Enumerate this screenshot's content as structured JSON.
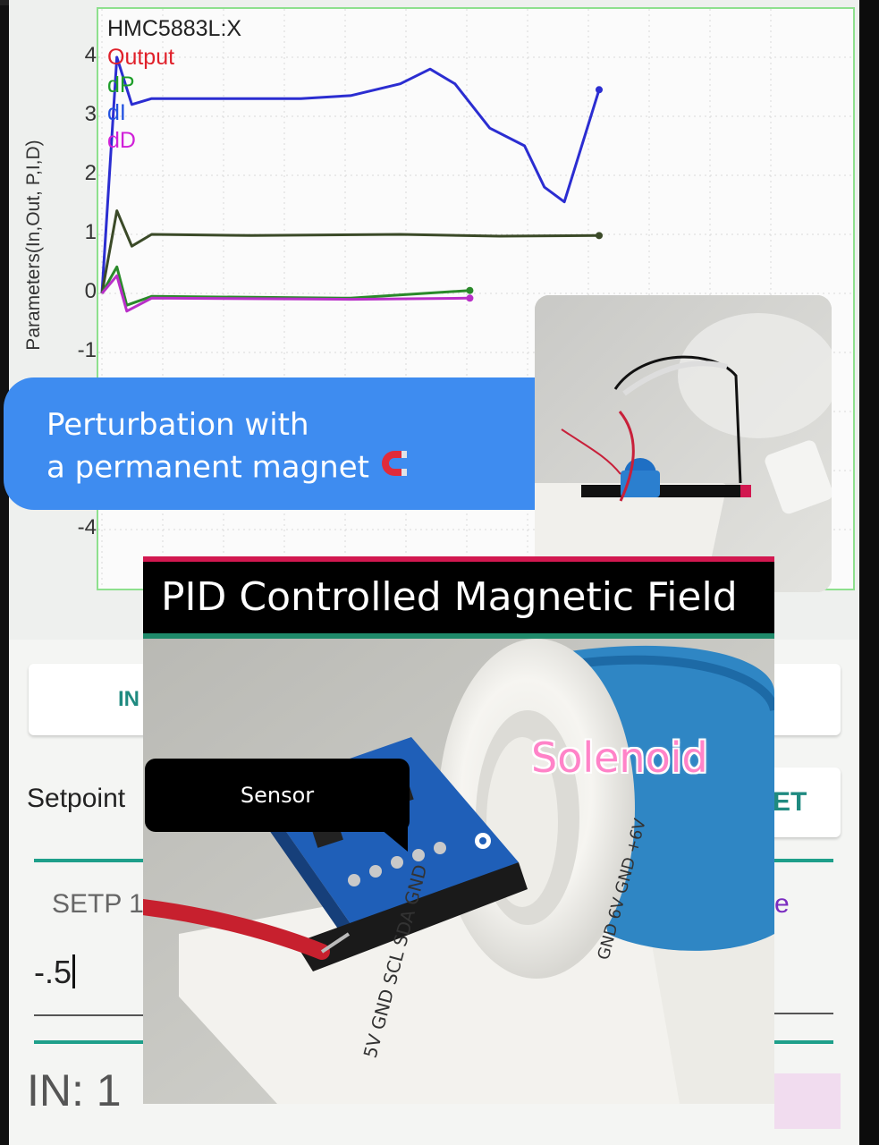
{
  "chart_data": {
    "type": "line",
    "title": "HMC5883L:X",
    "ylabel": "Parameters(In,Out, P,I,D)",
    "ylim": [
      -4,
      4
    ],
    "yticks": [
      "4",
      "3",
      "2",
      "1",
      "0",
      "-1",
      "-4"
    ],
    "legend": [
      "Output",
      "dP",
      "dI",
      "dD"
    ],
    "legend_colors": [
      "#e0202a",
      "#1e9e2a",
      "#2050e0",
      "#d020d8"
    ],
    "series": [
      {
        "name": "Output",
        "color": "#2b2dd1",
        "x": [
          0,
          0.3,
          0.6,
          1,
          2,
          4,
          5,
          6,
          6.6,
          7.1,
          7.8,
          8.5,
          8.9,
          9.3,
          10
        ],
        "y": [
          0,
          4.0,
          3.2,
          3.3,
          3.3,
          3.3,
          3.35,
          3.55,
          3.8,
          3.55,
          2.8,
          2.5,
          1.8,
          1.55,
          3.45
        ]
      },
      {
        "name": "dP",
        "color": "#3b4a28",
        "x": [
          0,
          0.3,
          0.6,
          1,
          3,
          6,
          8,
          10
        ],
        "y": [
          0,
          1.4,
          0.8,
          1.0,
          0.98,
          1.0,
          0.97,
          0.98
        ]
      },
      {
        "name": "dI",
        "color": "#2a8a2a",
        "x": [
          0,
          0.3,
          0.5,
          1,
          5,
          7.4
        ],
        "y": [
          0,
          0.45,
          -0.2,
          -0.05,
          -0.08,
          0.05
        ]
      },
      {
        "name": "dD",
        "color": "#b92fc8",
        "x": [
          0,
          0.3,
          0.5,
          1,
          5,
          7.4
        ],
        "y": [
          0,
          0.3,
          -0.3,
          -0.08,
          -0.1,
          -0.08
        ]
      }
    ]
  },
  "overlay": {
    "bubble_line1": "Perturbation with",
    "bubble_line2": "a permanent magnet",
    "video_title": "PID Controlled Magnetic Field",
    "solenoid_label": "Solenoid",
    "sensor_label": "Sensor"
  },
  "app": {
    "in_button": "IN",
    "set_button": "ET",
    "setpoint_label": "Setpoint",
    "setp_text": "SETP 1",
    "right_e": "e",
    "field_value": "-.5",
    "in_status": "IN: 1"
  },
  "colors": {
    "accent_teal": "#1e9f8a",
    "bubble_blue": "#3e8cf0",
    "solenoid_pink": "#ff83c8"
  }
}
